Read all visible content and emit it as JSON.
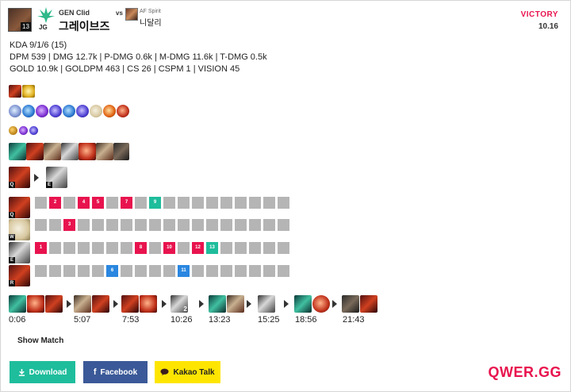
{
  "header": {
    "champion_level": "13",
    "role": "JG",
    "player_team": "GEN Clid",
    "player_name": "그레이브즈",
    "vs": "vs",
    "opponent_team": "AF Spirit",
    "opponent_name": "니달리",
    "result": "VICTORY",
    "patch": "10.16"
  },
  "stats": {
    "kda": "KDA 9/1/6 (15)",
    "damage": "DPM 539 | DMG 12.7k | P-DMG 0.6k | M-DMG 11.6k | T-DMG 0.5k",
    "economy": "GOLD 10.9k | GOLDPM 463 | CS 26 | CSPM 1 | VISION 45"
  },
  "skill_keys": [
    "Q",
    "W",
    "E",
    "R"
  ],
  "skill_order": {
    "Q": [
      "",
      "2",
      "",
      "4",
      "5",
      "",
      "7",
      "",
      "9",
      "",
      "",
      "",
      "",
      "",
      "",
      "",
      "",
      ""
    ],
    "W": [
      "",
      "",
      "3",
      "",
      "",
      "",
      "",
      "",
      "",
      "",
      "",
      "",
      "",
      "",
      "",
      "",
      "",
      ""
    ],
    "E": [
      "1",
      "",
      "",
      "",
      "",
      "",
      "",
      "8",
      "",
      "10",
      "",
      "12",
      "13",
      "",
      "",
      "",
      "",
      ""
    ],
    "R": [
      "",
      "",
      "",
      "",
      "",
      "6",
      "",
      "",
      "",
      "",
      "11",
      "",
      "",
      "",
      "",
      "",
      "",
      ""
    ]
  },
  "build_times": [
    "0:06",
    "5:07",
    "7:53",
    "10:26",
    "13:23",
    "15:25",
    "18:56",
    "21:43"
  ],
  "build_stack": "2",
  "show_match": "Show Match",
  "buttons": {
    "download": "Download",
    "facebook": "Facebook",
    "kakao": "Kakao Talk"
  },
  "brand": "QWER.GG",
  "colors": {
    "accent": "#e8134e",
    "teal": "#1ebd9c",
    "blue": "#2a87e0",
    "facebook": "#3b5998",
    "kakao": "#fee500"
  }
}
